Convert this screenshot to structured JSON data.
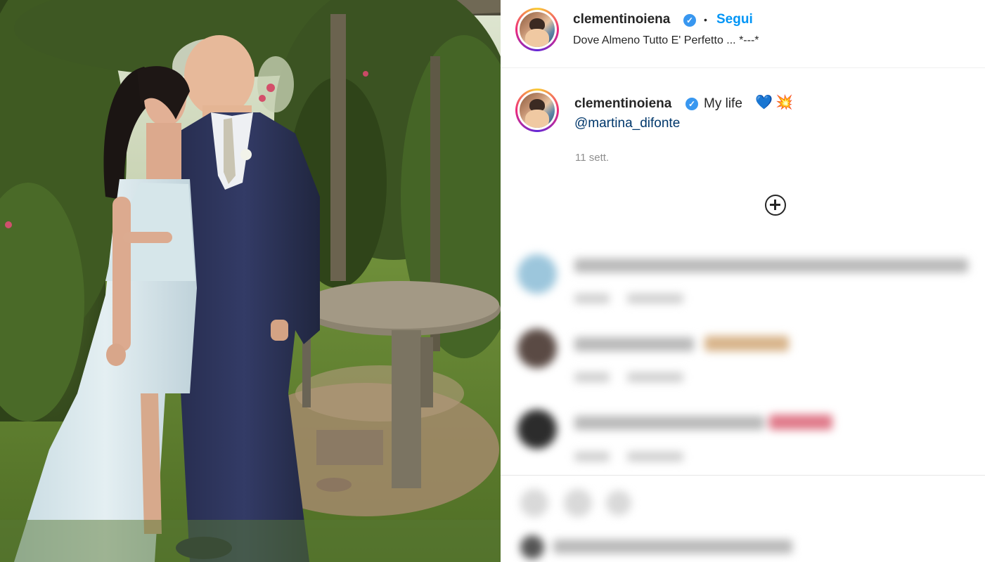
{
  "post": {
    "username": "clementinoiena",
    "verified_mark": "✓",
    "dot": "•",
    "follow_label": "Segui",
    "location": "Dove Almeno Tutto E' Perfetto ... *---*"
  },
  "caption": {
    "username": "clementinoiena",
    "text": "My life",
    "emoji_heart": "💙",
    "emoji_sparkle": "💥",
    "mention": "@martina_difonte",
    "time": "11 sett."
  },
  "icons": {
    "verified": "verified-badge-icon",
    "load_more": "plus-circle-icon"
  },
  "colors": {
    "link_blue": "#0095f6",
    "mention_blue": "#00376b",
    "verified_blue": "#3897f0",
    "muted_gray": "#8e8e8e"
  }
}
